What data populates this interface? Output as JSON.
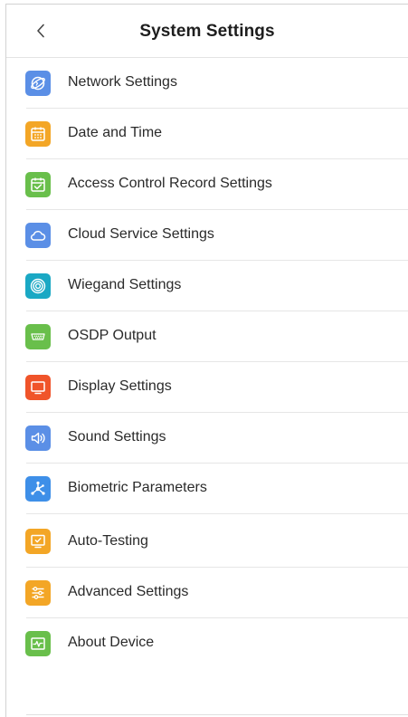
{
  "header": {
    "title": "System Settings",
    "back_icon": "chevron-left-icon"
  },
  "menu": {
    "items": [
      {
        "label": "Network Settings",
        "icon": "globe-icon",
        "color": "#5b8fe6"
      },
      {
        "label": "Date and Time",
        "icon": "calendar-icon",
        "color": "#f3a626"
      },
      {
        "label": "Access Control Record Settings",
        "icon": "calendar-check-icon",
        "color": "#69bf4b"
      },
      {
        "label": "Cloud Service Settings",
        "icon": "cloud-icon",
        "color": "#5b8fe6"
      },
      {
        "label": "Wiegand Settings",
        "icon": "target-icon",
        "color": "#1aa8c4"
      },
      {
        "label": "OSDP Output",
        "icon": "serial-port-icon",
        "color": "#69bf4b"
      },
      {
        "label": "Display Settings",
        "icon": "monitor-icon",
        "color": "#f0542a"
      },
      {
        "label": "Sound Settings",
        "icon": "speaker-icon",
        "color": "#5b8fe6"
      },
      {
        "label": "Biometric Parameters",
        "icon": "network-nodes-icon",
        "color": "#3e8fe8"
      },
      {
        "label": "Auto-Testing",
        "icon": "monitor-check-icon",
        "color": "#f3a626"
      },
      {
        "label": "Advanced Settings",
        "icon": "sliders-icon",
        "color": "#f3a626"
      },
      {
        "label": "About Device",
        "icon": "device-pulse-icon",
        "color": "#69bf4b"
      }
    ]
  }
}
